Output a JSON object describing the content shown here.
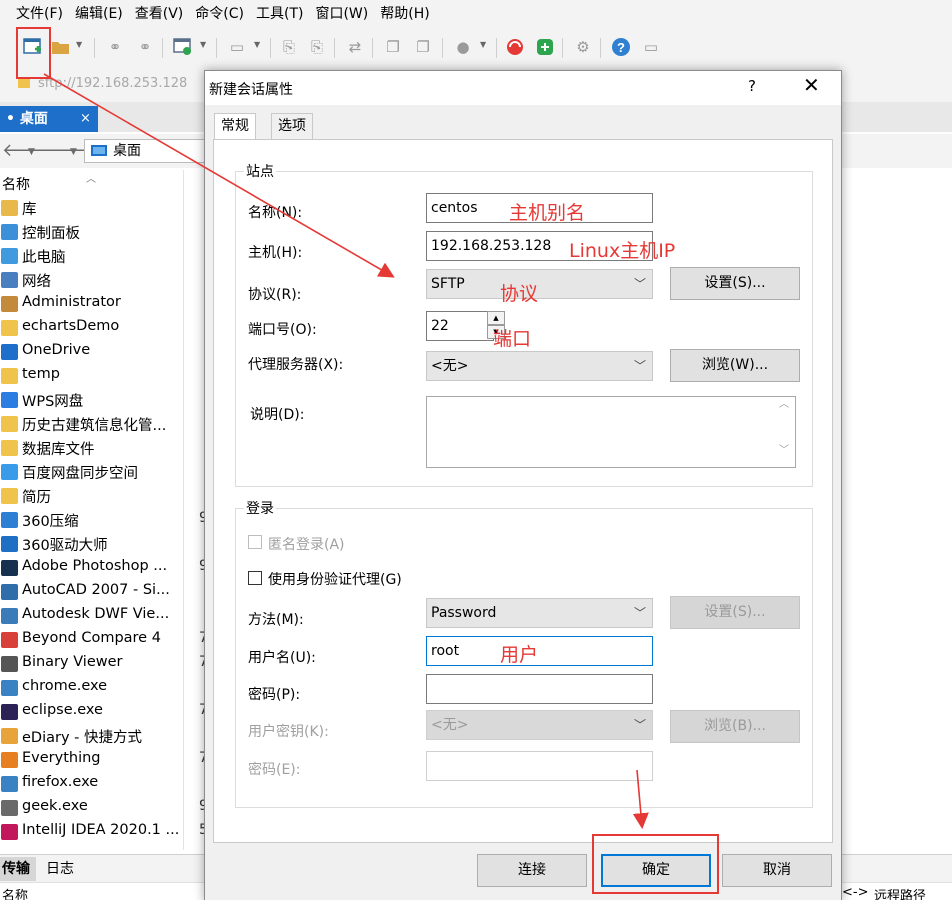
{
  "menu": [
    "文件(F)",
    "编辑(E)",
    "查看(V)",
    "命令(C)",
    "工具(T)",
    "窗口(W)",
    "帮助(H)"
  ],
  "address": "sftp://192.168.253.128",
  "tab": {
    "label": "桌面",
    "close": "×"
  },
  "nav": {
    "path": "桌面"
  },
  "file_list": {
    "column_name": "名称",
    "rows": [
      {
        "name": "库",
        "num": "",
        "color": "#e8b84a"
      },
      {
        "name": "控制面板",
        "num": "",
        "color": "#3c8fd9"
      },
      {
        "name": "此电脑",
        "num": "",
        "color": "#3f9ae0"
      },
      {
        "name": "网络",
        "num": "",
        "color": "#4a7fbf"
      },
      {
        "name": "Administrator",
        "num": "",
        "color": "#c28a3a"
      },
      {
        "name": "echartsDemo",
        "num": "",
        "color": "#f0c44c"
      },
      {
        "name": "OneDrive",
        "num": "",
        "color": "#1e6fc9"
      },
      {
        "name": "temp",
        "num": "",
        "color": "#f0c44c"
      },
      {
        "name": "WPS网盘",
        "num": "",
        "color": "#2a7de1"
      },
      {
        "name": "历史古建筑信息化管...",
        "num": "",
        "color": "#f0c44c"
      },
      {
        "name": "数据库文件",
        "num": "",
        "color": "#f0c44c"
      },
      {
        "name": "百度网盘同步空间",
        "num": "",
        "color": "#3a9be8"
      },
      {
        "name": "简历",
        "num": "",
        "color": "#f0c44c"
      },
      {
        "name": "360压缩",
        "num": "9",
        "color": "#2d7fd6"
      },
      {
        "name": "360驱动大师",
        "num": "",
        "color": "#1f6fc4"
      },
      {
        "name": "Adobe Photoshop ...",
        "num": "9",
        "color": "#16304f"
      },
      {
        "name": "AutoCAD 2007 - Si...",
        "num": "",
        "color": "#2f6ea8"
      },
      {
        "name": "Autodesk DWF Vie...",
        "num": "",
        "color": "#3a7bb8"
      },
      {
        "name": "Beyond Compare 4",
        "num": "7",
        "color": "#d8413a"
      },
      {
        "name": "Binary Viewer",
        "num": "7",
        "color": "#555555"
      },
      {
        "name": "chrome.exe",
        "num": "",
        "color": "#3b82c4"
      },
      {
        "name": "eclipse.exe",
        "num": "7",
        "color": "#2c2255"
      },
      {
        "name": "eDiary - 快捷方式",
        "num": "",
        "color": "#e8a33a"
      },
      {
        "name": "Everything",
        "num": "7",
        "color": "#e67e22"
      },
      {
        "name": "firefox.exe",
        "num": "",
        "color": "#3b82c4"
      },
      {
        "name": "geek.exe",
        "num": "9",
        "color": "#6a6a6a"
      },
      {
        "name": "IntelliJ IDEA 2020.1 ...",
        "num": "5",
        "color": "#c2185b"
      }
    ]
  },
  "bottom": {
    "transfer_tab": "传输",
    "log_tab": "日志",
    "col_name": "名称",
    "col_arrow": "<->",
    "col_remote": "远程路径"
  },
  "dialog": {
    "title": "新建会话属性",
    "help": "?",
    "close": "✕",
    "tabs": [
      "常规",
      "选项"
    ],
    "site_group": "站点",
    "name_label": "名称(N):",
    "name_value": "centos",
    "host_label": "主机(H):",
    "host_value": "192.168.253.128",
    "protocol_label": "协议(R):",
    "protocol_value": "SFTP",
    "settings_button": "设置(S)...",
    "port_label": "端口号(O):",
    "port_value": "22",
    "proxy_label": "代理服务器(X):",
    "proxy_value": "<无>",
    "browse_button": "浏览(W)...",
    "desc_label": "说明(D):",
    "login_group": "登录",
    "anon_label": "匿名登录(A)",
    "agent_label": "使用身份验证代理(G)",
    "method_label": "方法(M):",
    "method_value": "Password",
    "method_settings_button": "设置(S)...",
    "user_label": "用户名(U):",
    "user_value": "root",
    "password_label": "密码(P):",
    "userkey_label": "用户密钥(K):",
    "userkey_value": "<无>",
    "userkey_browse_button": "浏览(B)...",
    "passphrase_label": "密码(E):",
    "connect_button": "连接",
    "ok_button": "确定",
    "cancel_button": "取消"
  },
  "annotations": {
    "alias": "主机别名",
    "host_ip": "Linux主机IP",
    "protocol": "协议",
    "port": "端口",
    "user": "用户"
  },
  "colors": {
    "accent": "#1e6fc9",
    "annotation": "#e53935",
    "focus": "#0078d7"
  }
}
